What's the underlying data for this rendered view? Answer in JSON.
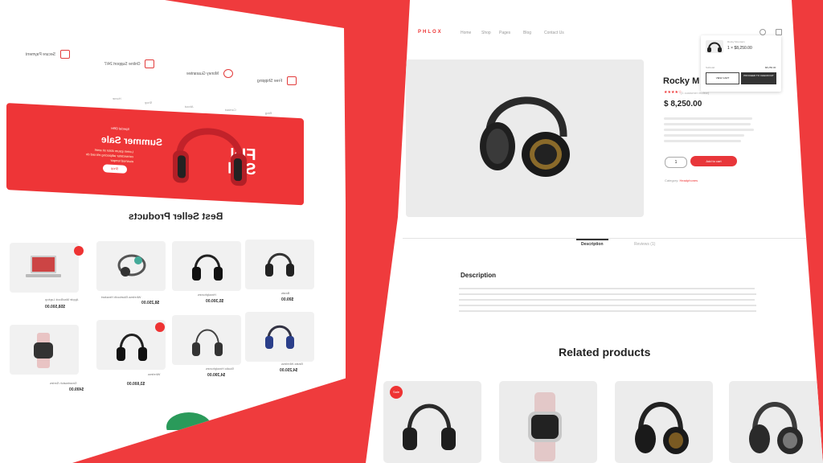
{
  "left": {
    "services": [
      "Secure Payment",
      "Online Support 24/7",
      "Money Guarantee",
      "Free Shipping"
    ],
    "nav": [
      "Home",
      "Shop",
      "About",
      "Contact",
      "Blog"
    ],
    "hero": {
      "kicker": "Special Offer",
      "title": "Summer Sale",
      "subtitle": "Lorem ipsum dolor sit amet consectetur adipiscing elit sed do eiusmod tempor",
      "button": "Shop",
      "big_line1": "FIN",
      "big_line2": "SMI"
    },
    "best_title": "Best Seller Products",
    "products": [
      {
        "name": "Beats",
        "price": "$99.00"
      },
      {
        "name": "Headphones",
        "price": "$5,300.00"
      },
      {
        "name": "Wireless Bluetooth Headset",
        "price": "$8,250.00"
      },
      {
        "name": "Apple MacBook Laptop",
        "price": "$58,500.00"
      },
      {
        "name": "Beats Wireless",
        "price": "$4,250.00"
      },
      {
        "name": "Studio Headphones",
        "price": "$4,390.00"
      },
      {
        "name": "Wireless",
        "price": "$3,600.00"
      },
      {
        "name": "Smartwatch Series",
        "price": "$499.00"
      }
    ]
  },
  "right": {
    "logo": "PHLOX",
    "nav": [
      "Home",
      "Shop",
      "Pages",
      "Blog",
      "Contact Us"
    ],
    "product": {
      "name": "Rocky M",
      "stars": "★★★★☆",
      "reviews": "(1 customer review)",
      "price": "$ 8,250.00",
      "qty": "1",
      "add_to_cart": "Add to cart",
      "category_label": "Category:",
      "category_value": "Headphones"
    },
    "mini_cart": {
      "item_name": "Rocky Mountain",
      "item_qty_price": "1 × $8,250.00",
      "subtotal_label": "Subtotal:",
      "subtotal_value": "$8,250.00",
      "view_cart": "VIEW CART",
      "checkout": "PROCEED TO CHECKOUT"
    },
    "tabs": [
      "Description",
      "Reviews (1)"
    ],
    "description_title": "Description",
    "related_title": "Related products",
    "sale_badge": "Sale"
  }
}
